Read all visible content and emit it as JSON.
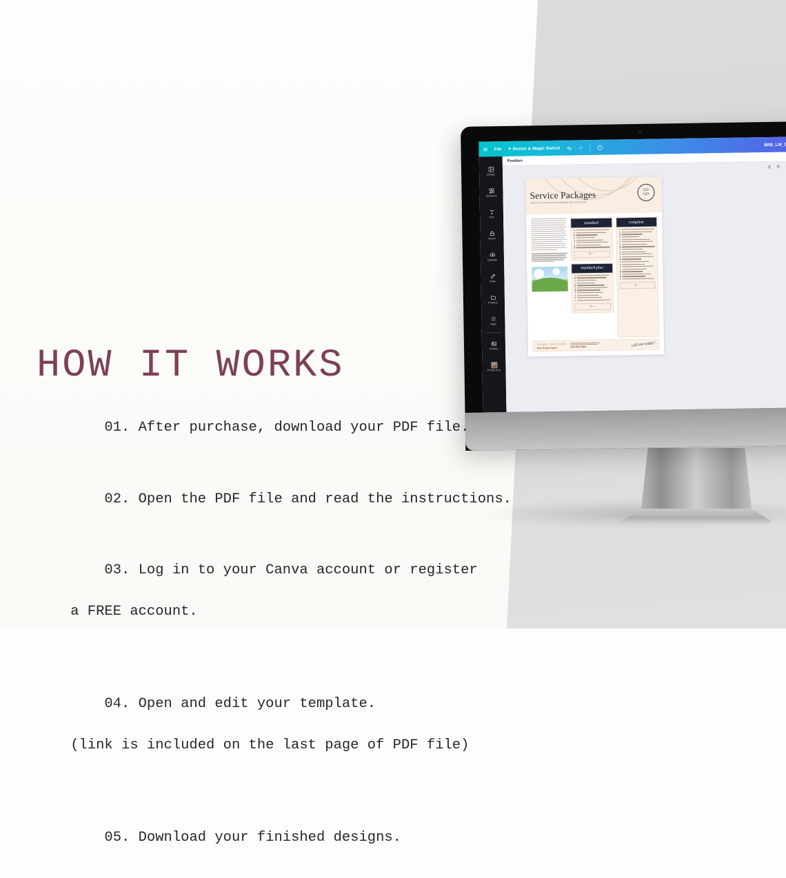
{
  "heading": "HOW IT WORKS",
  "heading_color": "#7d4152",
  "steps": [
    {
      "line1": "01. After purchase, download your PDF file.",
      "line2": ""
    },
    {
      "line1": "02. Open the PDF file and read the instructions.",
      "line2": ""
    },
    {
      "line1": "03. Log in to your Canva account or register",
      "line2": "a FREE account."
    },
    {
      "line1": "04. Open and edit your template.",
      "line2": "(link is included on the last page of PDF file)"
    },
    {
      "line1": "05. Download your finished designs.",
      "line2": ""
    }
  ],
  "canva": {
    "topbar": {
      "menu_icon": "hamburger-icon",
      "file_label": "File",
      "resize_label": "Resize & Magic Switch",
      "undo_icon": "undo-icon",
      "redo_icon": "redo-icon",
      "cloud_icon": "cloud-saved-icon",
      "design_title": "BRE_LM_Commission-S"
    },
    "sidebar": [
      {
        "label": "Design",
        "icon": "design-icon"
      },
      {
        "label": "Elements",
        "icon": "elements-icon"
      },
      {
        "label": "Text",
        "icon": "text-icon"
      },
      {
        "label": "Brand",
        "icon": "brand-icon"
      },
      {
        "label": "Uploads",
        "icon": "uploads-icon"
      },
      {
        "label": "Draw",
        "icon": "draw-icon"
      },
      {
        "label": "Projects",
        "icon": "projects-icon"
      },
      {
        "label": "Apps",
        "icon": "apps-icon"
      },
      {
        "label": "Photos",
        "icon": "photos-icon"
      },
      {
        "label": "Profile Pics",
        "icon": "profile-pics-icon"
      }
    ],
    "position_label": "Position",
    "canvas_tools": [
      "lock-icon",
      "duplicate-icon",
      "share-icon"
    ],
    "refresh_icon": "refresh-icon"
  },
  "document": {
    "title": "Service Packages",
    "subtitle": "Here's our list of service packages that we provide.",
    "logo_line1": "LO",
    "logo_line2": "GO",
    "packages": [
      {
        "name": "standard",
        "price": "$---"
      },
      {
        "name": "complete",
        "price": "$---"
      },
      {
        "name": "standard plus",
        "price": "$---"
      }
    ],
    "footer": {
      "name": "NAME JOHNSON",
      "role": "Real Estate Agent",
      "phone": "123-456-7890",
      "cta": "call me today!"
    }
  },
  "colors": {
    "bg_left": "#fdfdfb",
    "bg_right": "#dcdcdc",
    "accent_wine": "#7d4152",
    "canva_teal": "#00c4cc",
    "canva_blue": "#5b57e8",
    "doc_navy": "#1e2436",
    "doc_cream": "#faeee3"
  }
}
